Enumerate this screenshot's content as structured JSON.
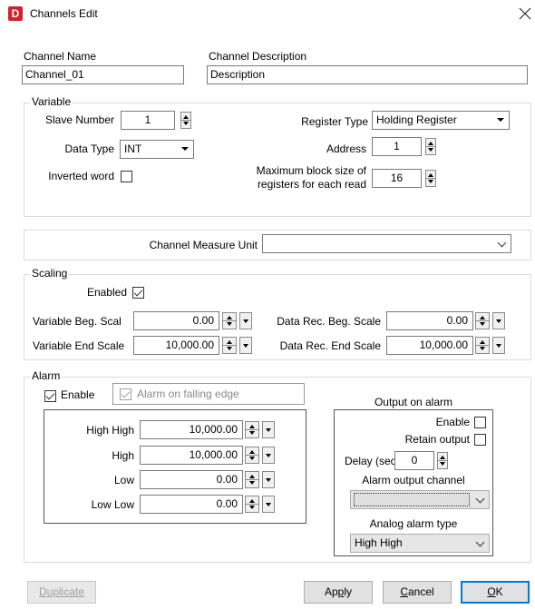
{
  "window": {
    "title": "Channels Edit",
    "app_icon_letter": "D",
    "brand_color": "#d6202a"
  },
  "channel": {
    "name_label": "Channel Name",
    "name_value": "Channel_01",
    "desc_label": "Channel Description",
    "desc_value": "Description"
  },
  "variable": {
    "group_label": "Variable",
    "slave_number_label": "Slave Number",
    "slave_number_value": "1",
    "data_type_label": "Data Type",
    "data_type_value": "INT",
    "inverted_word_label": "Inverted word",
    "inverted_word_checked": false,
    "register_type_label": "Register Type",
    "register_type_value": "Holding Register",
    "address_label": "Address",
    "address_value": "1",
    "max_block_label_1": "Maximum block size of",
    "max_block_label_2": "registers for each read",
    "max_block_value": "16"
  },
  "measure": {
    "label": "Channel Measure Unit",
    "value": ""
  },
  "scaling": {
    "group_label": "Scaling",
    "enabled_label": "Enabled",
    "enabled_checked": true,
    "var_beg_label": "Variable Beg. Scal",
    "var_beg_value": "0.00",
    "var_end_label": "Variable End Scale",
    "var_end_value": "10,000.00",
    "rec_beg_label": "Data Rec. Beg. Scale",
    "rec_beg_value": "0.00",
    "rec_end_label": "Data Rec. End Scale",
    "rec_end_value": "10,000.00"
  },
  "alarm": {
    "group_label": "Alarm",
    "enable_label": "Enable",
    "enable_checked": true,
    "falling_edge_label": "Alarm on falling edge",
    "falling_edge_checked": true,
    "high_high_label": "High High",
    "high_high_value": "10,000.00",
    "high_label": "High",
    "high_value": "10,000.00",
    "low_label": "Low",
    "low_value": "0.00",
    "low_low_label": "Low Low",
    "low_low_value": "0.00"
  },
  "output": {
    "title": "Output on alarm",
    "enable_label": "Enable",
    "enable_checked": false,
    "retain_label": "Retain output",
    "retain_checked": false,
    "delay_label": "Delay (sec.)",
    "delay_value": "0",
    "channel_label": "Alarm output channel",
    "channel_value": "",
    "analog_label": "Analog alarm type",
    "analog_value": "High High"
  },
  "buttons": {
    "duplicate": "Duplicate",
    "apply_pre": "Ap",
    "apply_u": "p",
    "apply_post": "ly",
    "cancel_u": "C",
    "cancel_post": "ancel",
    "ok_u": "O",
    "ok_post": "K"
  }
}
